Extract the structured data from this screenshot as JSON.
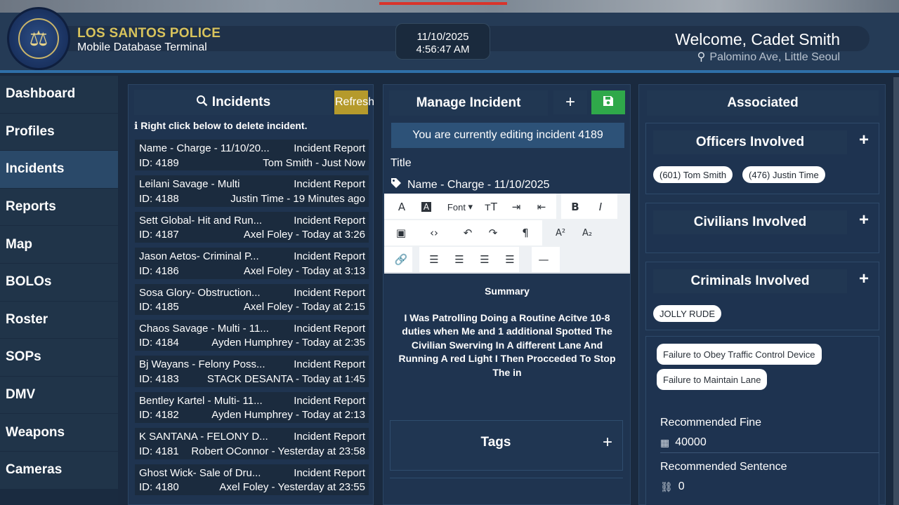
{
  "header": {
    "org_title": "LOS SANTOS POLICE",
    "org_subtitle": "Mobile Database Terminal",
    "date": "11/10/2025",
    "time": "4:56:47 AM",
    "welcome": "Welcome, Cadet Smith",
    "location": "Palomino Ave, Little Seoul"
  },
  "sidebar": {
    "items": [
      {
        "label": "Dashboard",
        "active": false
      },
      {
        "label": "Profiles",
        "active": false
      },
      {
        "label": "Incidents",
        "active": true
      },
      {
        "label": "Reports",
        "active": false
      },
      {
        "label": "Map",
        "active": false
      },
      {
        "label": "BOLOs",
        "active": false
      },
      {
        "label": "Roster",
        "active": false
      },
      {
        "label": "SOPs",
        "active": false
      },
      {
        "label": "DMV",
        "active": false
      },
      {
        "label": "Weapons",
        "active": false
      },
      {
        "label": "Cameras",
        "active": false
      }
    ]
  },
  "incidents": {
    "title": "Incidents",
    "refresh_label": "Refresh",
    "hint": "Right click below to delete incident.",
    "items": [
      {
        "name": "Name - Charge - 11/10/20...",
        "type": "Incident Report",
        "id": "ID: 4189",
        "meta": "Tom Smith - Just Now"
      },
      {
        "name": "Leilani Savage - Multi",
        "type": "Incident Report",
        "id": "ID: 4188",
        "meta": "Justin Time - 19 Minutes ago"
      },
      {
        "name": "Sett Global- Hit and Run...",
        "type": "Incident Report",
        "id": "ID: 4187",
        "meta": "Axel Foley - Today at 3:26"
      },
      {
        "name": "Jason Aetos- Criminal P...",
        "type": "Incident Report",
        "id": "ID: 4186",
        "meta": "Axel Foley - Today at 3:13"
      },
      {
        "name": "Sosa Glory- Obstruction...",
        "type": "Incident Report",
        "id": "ID: 4185",
        "meta": "Axel Foley - Today at 2:15"
      },
      {
        "name": "Chaos Savage - Multi - 11...",
        "type": "Incident Report",
        "id": "ID: 4184",
        "meta": "Ayden Humphrey - Today at 2:35"
      },
      {
        "name": "Bj Wayans - Felony Poss...",
        "type": "Incident Report",
        "id": "ID: 4183",
        "meta": "STACK DESANTA - Today at 1:45"
      },
      {
        "name": "Bentley Kartel - Multi- 11...",
        "type": "Incident Report",
        "id": "ID: 4182",
        "meta": "Ayden Humphrey - Today at 2:13"
      },
      {
        "name": "K SANTANA - FELONY D...",
        "type": "Incident Report",
        "id": "ID: 4181",
        "meta": "Robert OConnor - Yesterday at 23:58"
      },
      {
        "name": "Ghost Wick- Sale of Dru...",
        "type": "Incident Report",
        "id": "ID: 4180",
        "meta": "Axel Foley - Yesterday at 23:55"
      }
    ]
  },
  "manage": {
    "title": "Manage Incident",
    "plus": "+",
    "editing_notice": "You are currently editing incident 4189",
    "title_label": "Title",
    "title_value": "Name - Charge - 11/10/2025",
    "toolbar_font_label": "Font",
    "toolbar_bold": "B",
    "toolbar_italic": "I",
    "summary_heading": "Summary",
    "summary_text": "I Was Patrolling Doing a Routine Acitve 10-8 duties when Me and 1 additional Spotted The Civilian Swerving In A different Lane And Running A red Light I Then Procceded To Stop The in",
    "tags_title": "Tags",
    "tags_plus": "+",
    "save_color": "#2fa84a"
  },
  "associated": {
    "title": "Associated",
    "officers_title": "Officers Involved",
    "officers": [
      "(601) Tom Smith",
      "(476) Justin Time"
    ],
    "civilians_title": "Civilians Involved",
    "criminals_title": "Criminals Involved",
    "criminals": [
      "JOLLY RUDE"
    ],
    "charges": [
      "Failure to Obey Traffic Control Device",
      "Failure to Maintain Lane"
    ],
    "fine_label": "Recommended Fine",
    "fine_value": "40000",
    "sentence_label": "Recommended Sentence",
    "sentence_value": "0",
    "plus": "+"
  },
  "colors": {
    "accent_gold": "#d8c35c",
    "refresh_bg": "#b59a2c",
    "active_nav": "#2a4969",
    "editing_bg": "#2d5278"
  }
}
